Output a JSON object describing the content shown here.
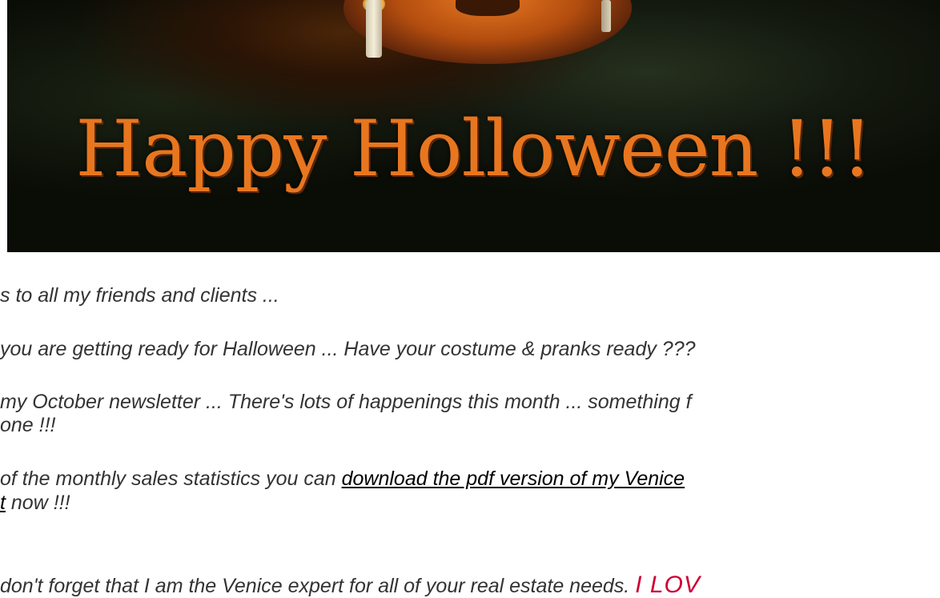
{
  "banner": {
    "title": "Happy Holloween !!!"
  },
  "content": {
    "line1": "s to all my friends and clients ...",
    "line2": "you are getting ready for Halloween ... Have your costume & pranks ready ???",
    "line3a": "my October newsletter ... There's lots of happenings this month ... something f",
    "line3b": "one !!!",
    "line4_prefix": " of the monthly sales statistics you can ",
    "line4_link": "download the pdf version of my Venice",
    "line5_link": "t",
    "line5_suffix": " now !!!",
    "line6": " don't forget that I am the Venice expert for all of your real estate needs. ",
    "line6_emphasis": "I LOV"
  },
  "colors": {
    "body_text": "#333333",
    "link": "#000000",
    "emphasis": "#cc0033",
    "banner_text": "#e8761f"
  }
}
